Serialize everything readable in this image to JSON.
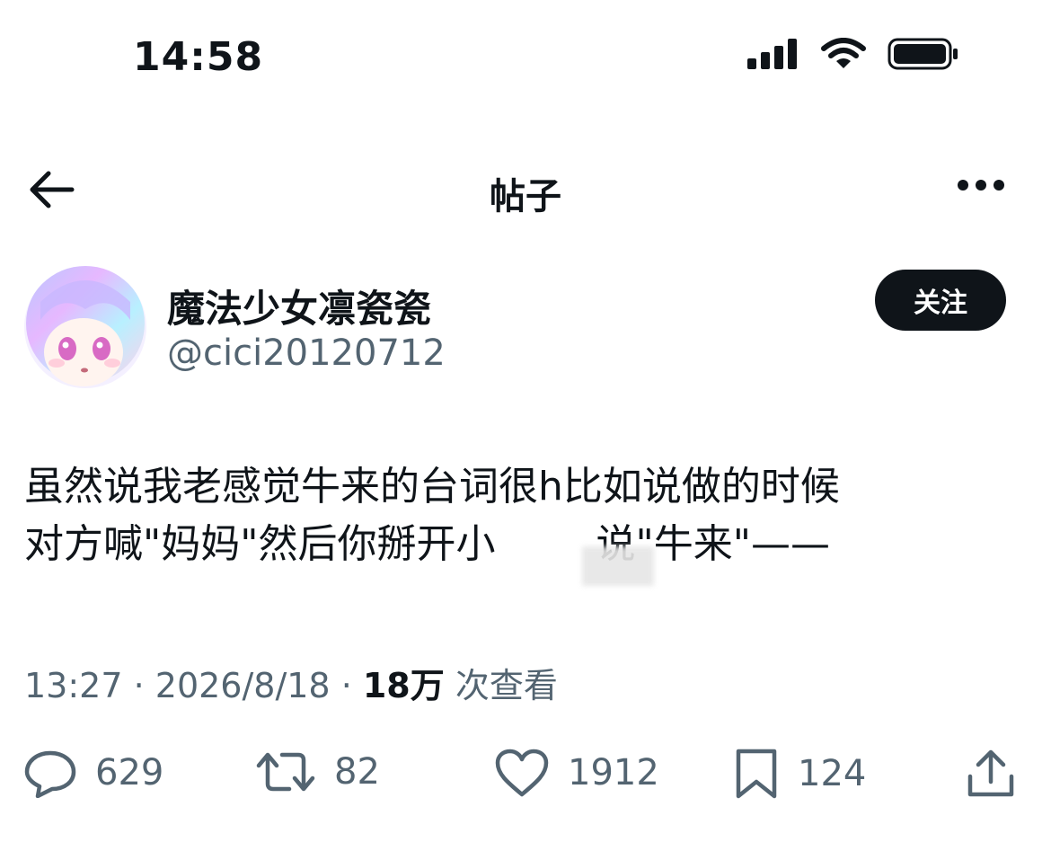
{
  "status_bar": {
    "time": "14:58"
  },
  "navbar": {
    "title": "帖子"
  },
  "author": {
    "display_name": "魔法少女凛瓷瓷",
    "handle": "@cici20120712",
    "follow_label": "关注"
  },
  "tweet": {
    "line1": "虽然说我老感觉牛来的台词很h比如说做的时候",
    "line2": "对方喊\"妈妈\"然后你掰开小",
    "line2_end": "说\"牛来\"——"
  },
  "meta": {
    "time": "13:27",
    "sep1": " · ",
    "date": "2026/8/18",
    "sep2": " · ",
    "views": "18万",
    "views_label": " 次查看"
  },
  "actions": {
    "replies": "629",
    "reposts": "82",
    "likes": "1912",
    "bookmarks": "124"
  },
  "icons": {
    "signal": "cellular-signal-icon",
    "wifi": "wifi-icon",
    "battery": "battery-icon",
    "back": "back-arrow-icon",
    "more": "more-dots-icon",
    "reply": "comment-bubble-icon",
    "repost": "repost-icon",
    "like": "heart-icon",
    "bookmark": "bookmark-icon",
    "share": "share-icon"
  }
}
